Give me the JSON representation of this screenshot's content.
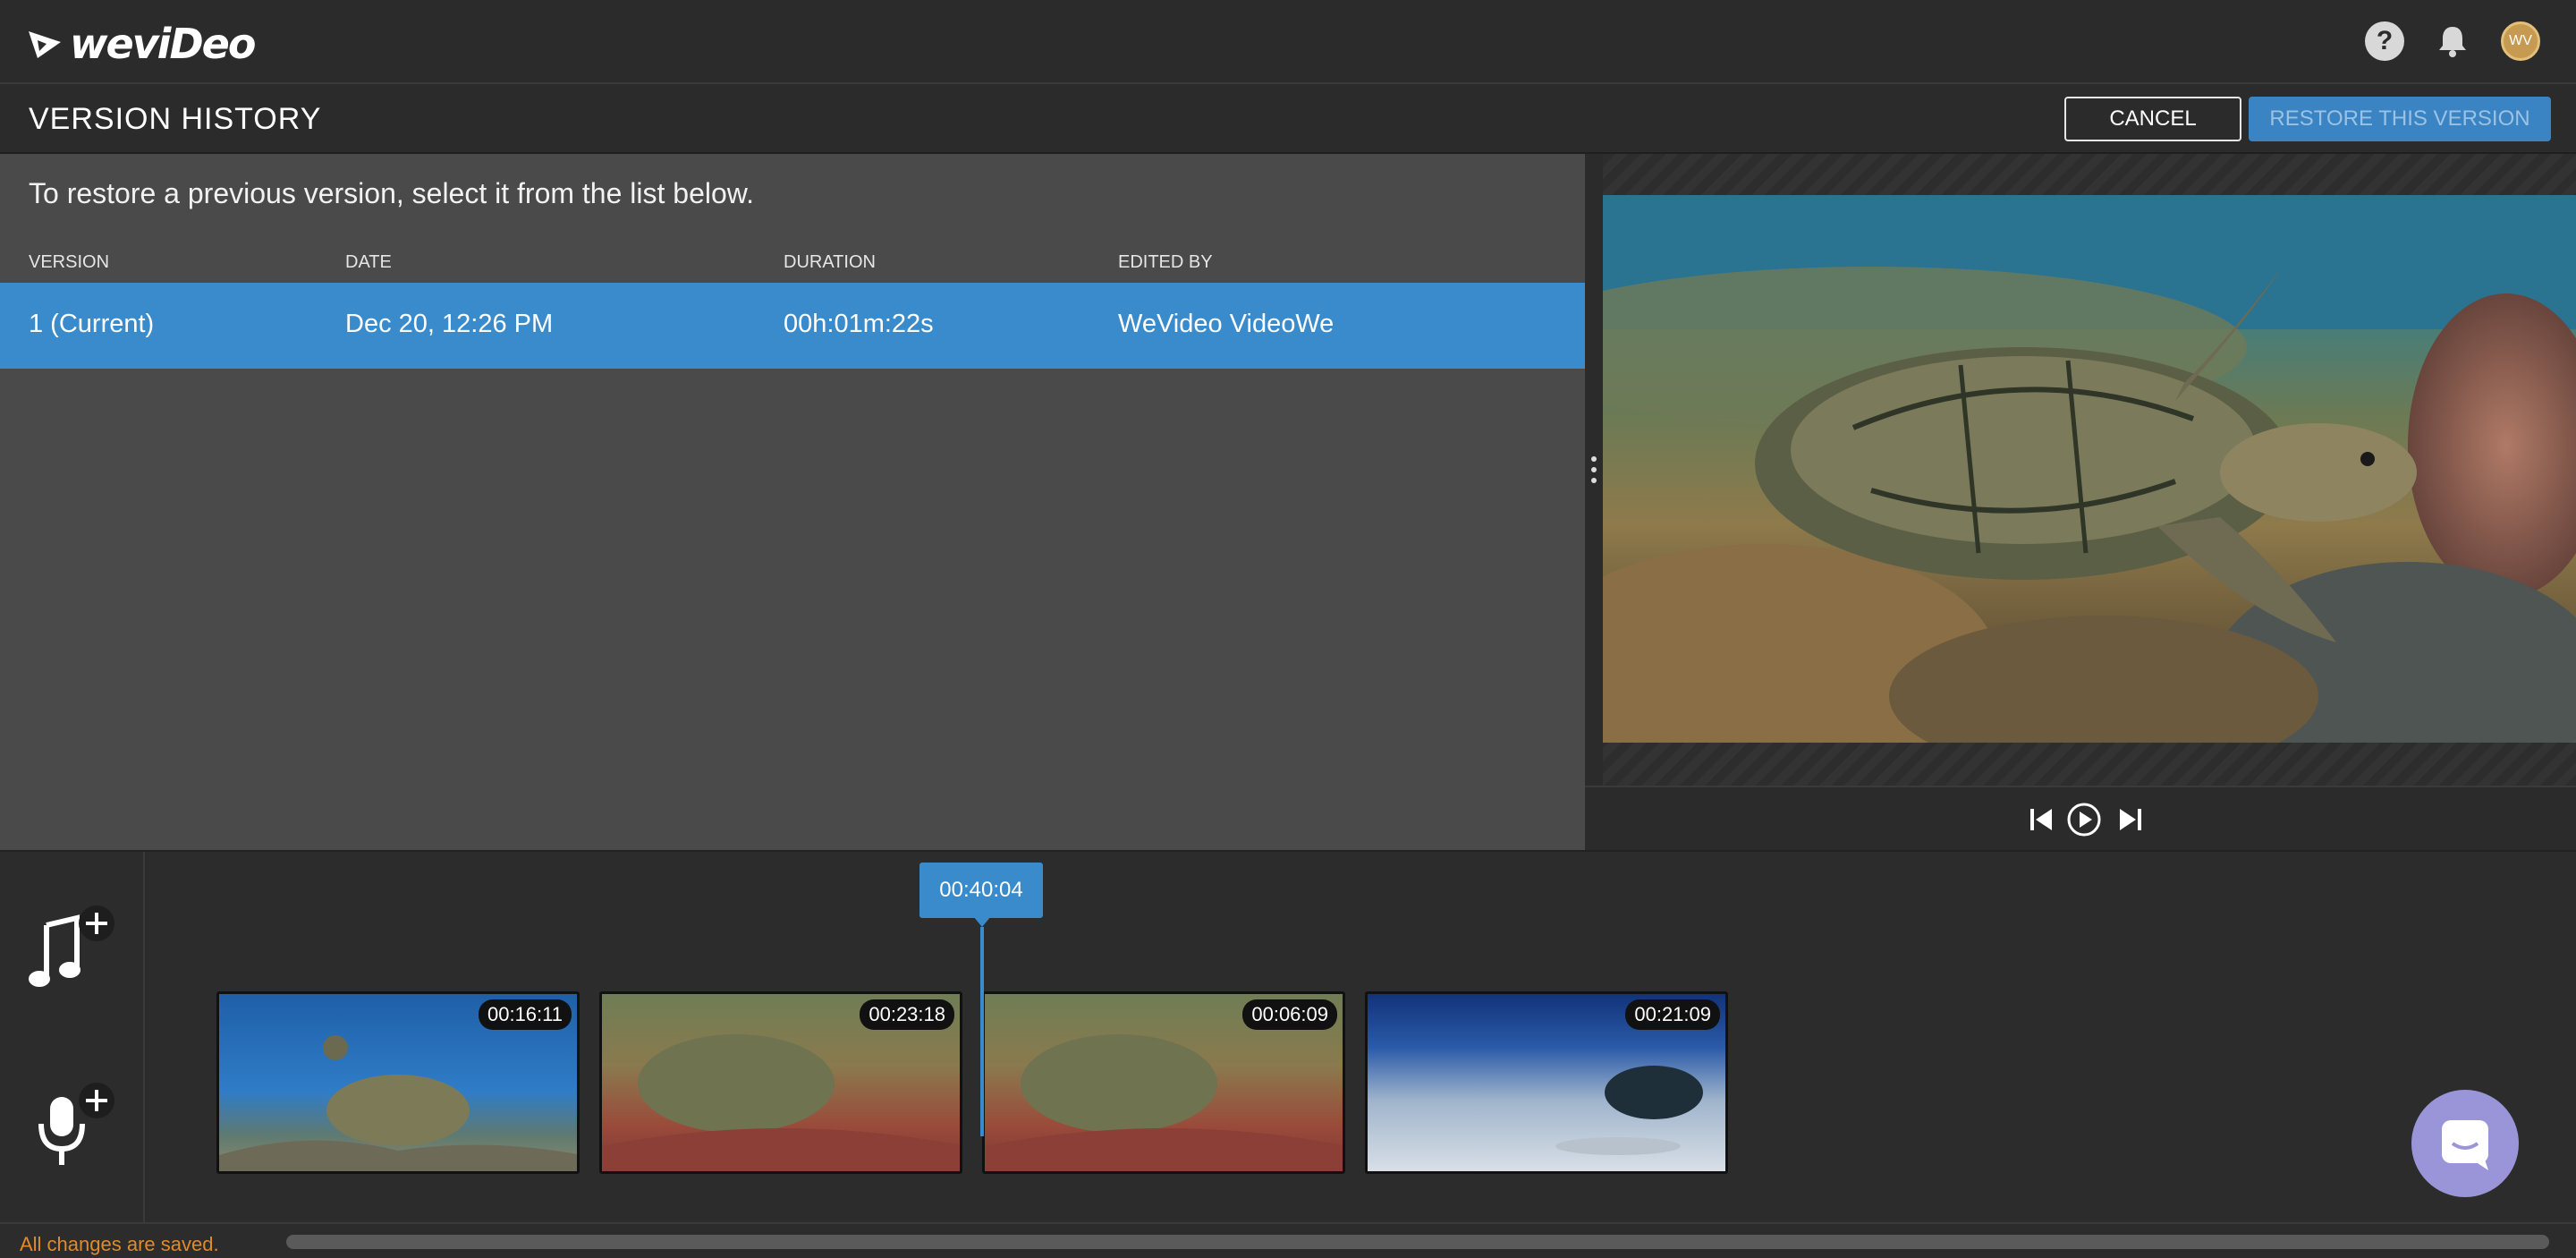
{
  "app": {
    "logo_text": "weviDeo",
    "avatar_initials": "WV"
  },
  "header": {
    "title": "VERSION HISTORY",
    "cancel_label": "CANCEL",
    "restore_label": "RESTORE THIS VERSION"
  },
  "version_panel": {
    "instructions": "To restore a previous version, select it from the list below.",
    "columns": [
      "VERSION",
      "DATE",
      "DURATION",
      "EDITED BY"
    ],
    "rows": [
      {
        "version": "1 (Current)",
        "date": "Dec 20, 12:26 PM",
        "duration": "00h:01m:22s",
        "edited_by": "WeVideo VideoWe"
      }
    ]
  },
  "player": {
    "controls": [
      "skip-back-icon",
      "play-icon",
      "skip-forward-icon"
    ]
  },
  "timeline": {
    "playhead_time": "00:40:04",
    "clips": [
      {
        "duration": "00:16:11"
      },
      {
        "duration": "00:23:18"
      },
      {
        "duration": "00:06:09"
      },
      {
        "duration": "00:21:09"
      }
    ]
  },
  "status": {
    "save_status": "All changes are saved."
  },
  "colors": {
    "accent": "#3a8bcb",
    "save_status": "#e08a2a",
    "chat": "#9a95d8"
  }
}
